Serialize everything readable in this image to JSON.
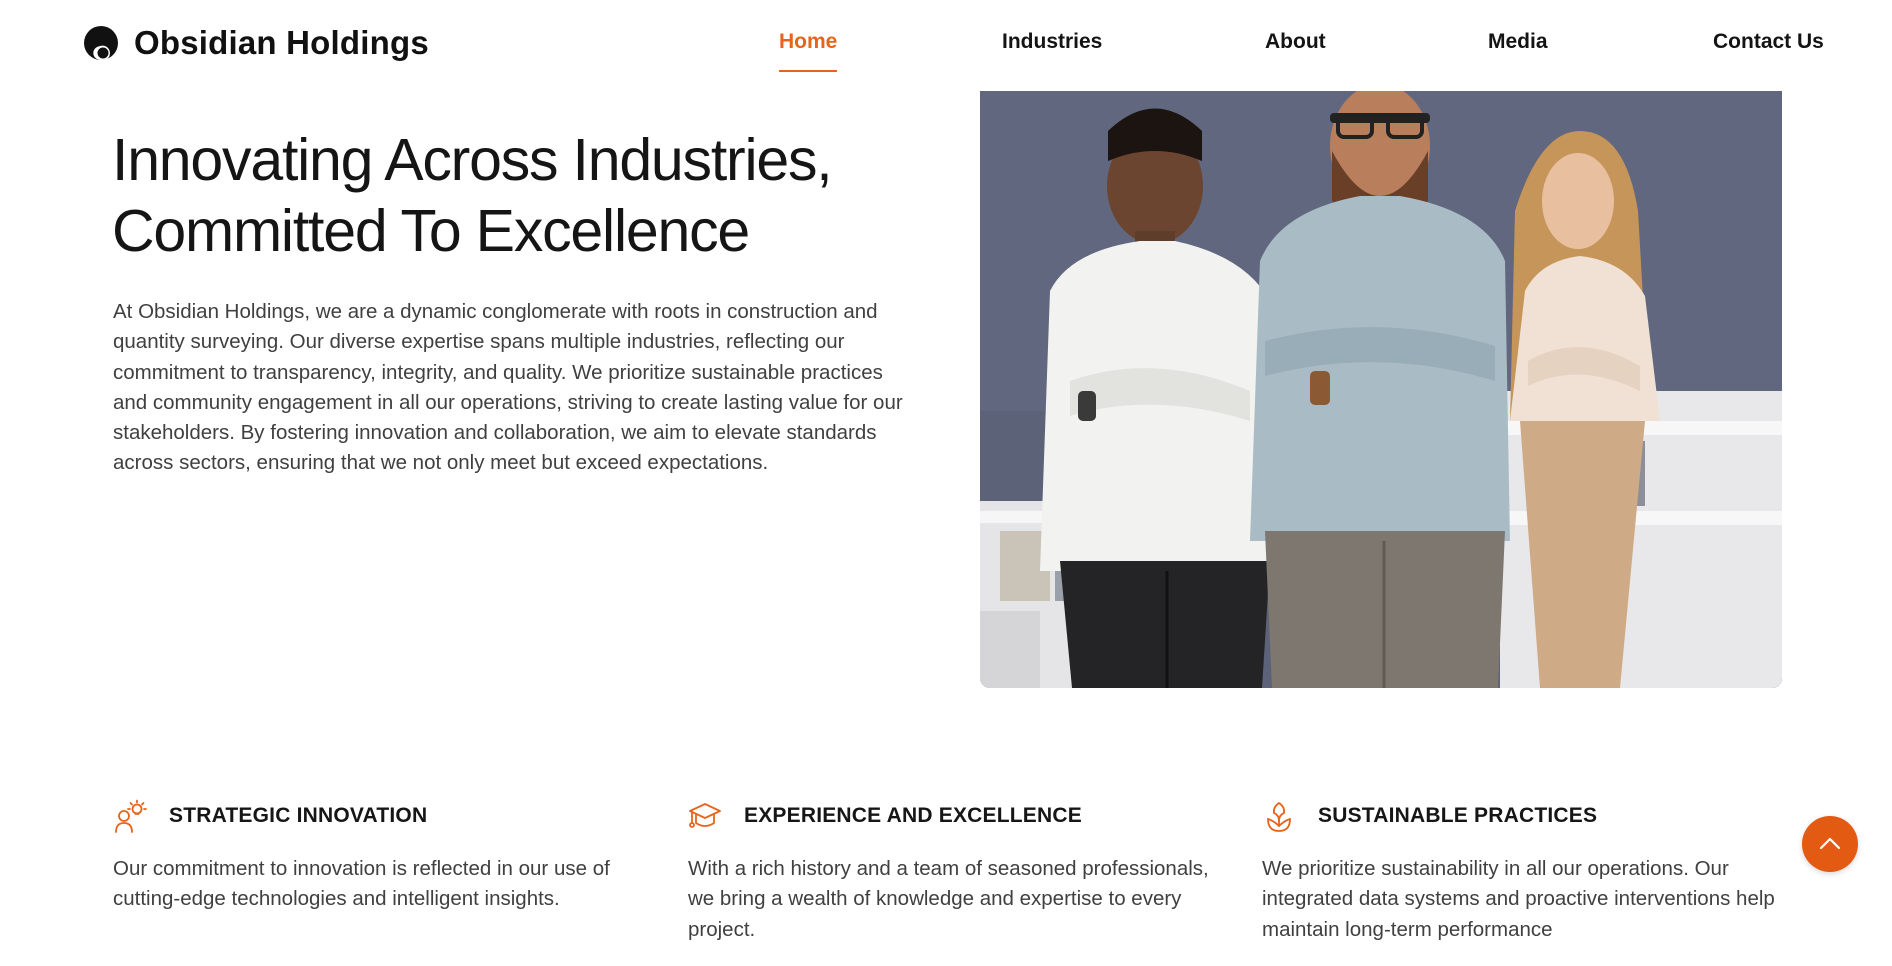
{
  "brand": {
    "name": "Obsidian Holdings",
    "accent_color": "#e8641c"
  },
  "nav": {
    "items": [
      {
        "label": "Home",
        "active": true
      },
      {
        "label": "Industries",
        "active": false
      },
      {
        "label": "About",
        "active": false
      },
      {
        "label": "Media",
        "active": false
      },
      {
        "label": "Contact Us",
        "active": false
      }
    ]
  },
  "hero": {
    "title_line1": "Innovating Across Industries,",
    "title_line2": "Committed To Excellence",
    "body": "At Obsidian Holdings, we are a dynamic conglomerate with roots in construction and quantity surveying. Our diverse expertise spans multiple industries, reflecting our commitment to transparency, integrity, and quality. We prioritize sustainable practices and community engagement in all our operations, striving to create lasting value for our stakeholders. By fostering innovation and collaboration, we aim to elevate standards across sectors, ensuring that we not only meet but exceed expectations."
  },
  "features": [
    {
      "icon": "idea-person-icon",
      "title": "STRATEGIC INNOVATION",
      "text": "Our commitment to innovation is reflected in our use of cutting-edge technologies and intelligent insights."
    },
    {
      "icon": "graduation-cap-icon",
      "title": "EXPERIENCE AND EXCELLENCE",
      "text": "With a rich history and a team of seasoned professionals, we bring a wealth of knowledge and expertise to every project."
    },
    {
      "icon": "sprout-icon",
      "title": "SUSTAINABLE PRACTICES",
      "text": "We prioritize sustainability in all our operations. Our integrated data systems and proactive interventions help maintain long-term performance"
    }
  ],
  "scroll_top": {
    "icon": "chevron-up-icon"
  }
}
